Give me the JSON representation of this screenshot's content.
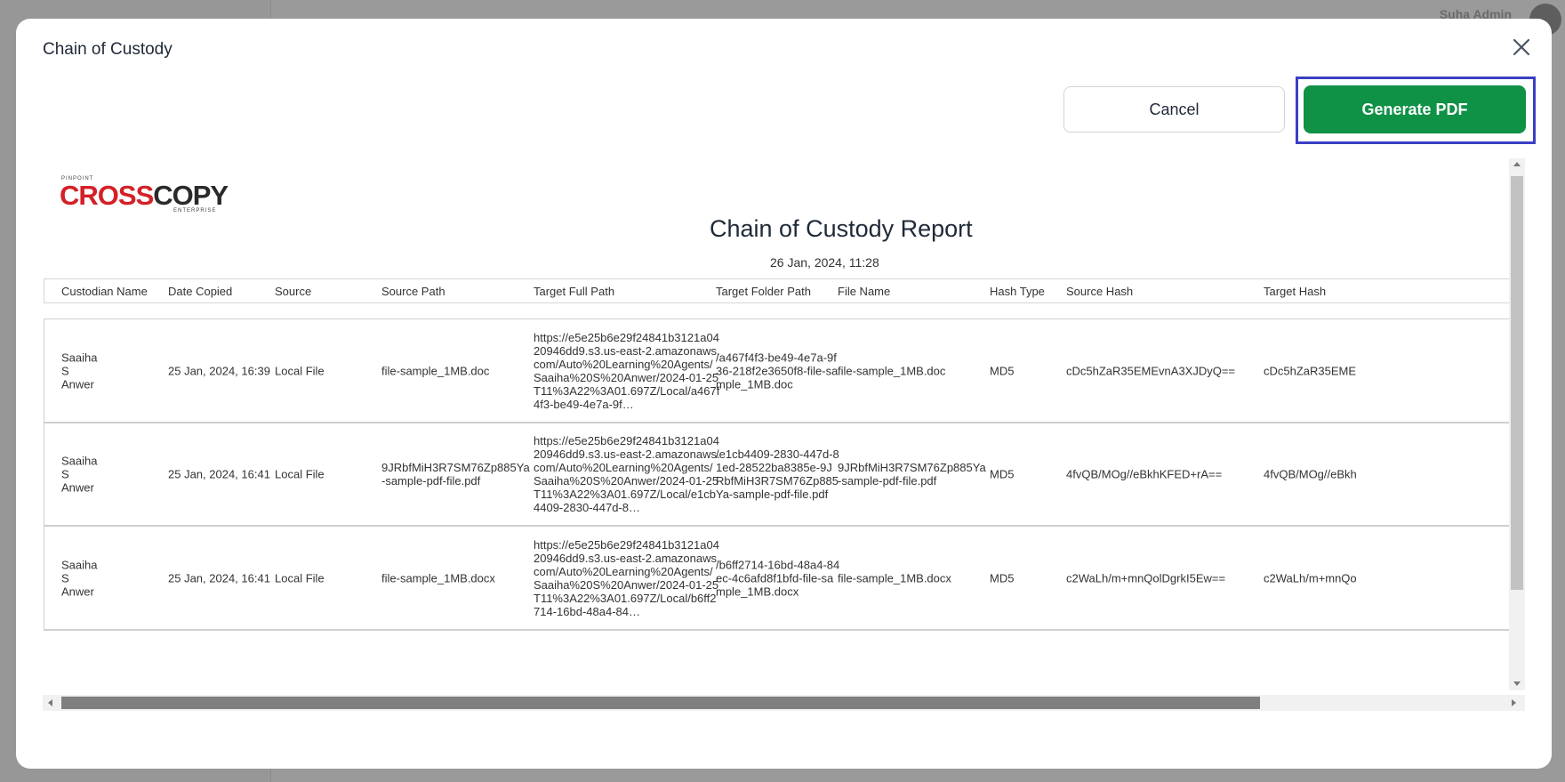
{
  "background": {
    "user_name": "Suha Admin"
  },
  "modal": {
    "title": "Chain of Custody",
    "cancel_label": "Cancel",
    "generate_label": "Generate PDF"
  },
  "report": {
    "logo": {
      "top_text": "PINPOINT",
      "cross": "CROSS",
      "copy": "COPY",
      "sub_text": "ENTERPRISE"
    },
    "title": "Chain of Custody Report",
    "date": "26 Jan, 2024, 11:28",
    "columns": [
      "Custodian Name",
      "Date Copied",
      "Source",
      "Source Path",
      "Target Full Path",
      "Target Folder Path",
      "File Name",
      "Hash Type",
      "Source Hash",
      "Target Hash"
    ],
    "rows": [
      {
        "custodian": "Saaiha\nS\nAnwer",
        "date_copied": "25 Jan, 2024, 16:39",
        "source": "Local File",
        "source_path": "file-sample_1MB.doc",
        "target_full_path": "https://e5e25b6e29f24841b3121a0420946dd9.s3.us-east-2.amazonaws.com/Auto%20Learning%20Agents/Saaiha%20S%20Anwer/2024-01-25T11%3A22%3A01.697Z/Local/a467f4f3-be49-4e7a-9f…",
        "target_folder_path": "/a467f4f3-be49-4e7a-9f36-218f2e3650f8-file-sample_1MB.doc",
        "file_name": "file-sample_1MB.doc",
        "hash_type": "MD5",
        "source_hash": "cDc5hZaR35EMEvnA3XJDyQ==",
        "target_hash": "cDc5hZaR35EME"
      },
      {
        "custodian": "Saaiha\nS\nAnwer",
        "date_copied": "25 Jan, 2024, 16:41",
        "source": "Local File",
        "source_path": "9JRbfMiH3R7SM76Zp885Ya-sample-pdf-file.pdf",
        "target_full_path": "https://e5e25b6e29f24841b3121a0420946dd9.s3.us-east-2.amazonaws.com/Auto%20Learning%20Agents/Saaiha%20S%20Anwer/2024-01-25T11%3A22%3A01.697Z/Local/e1cb4409-2830-447d-8…",
        "target_folder_path": "/e1cb4409-2830-447d-81ed-28522ba8385e-9JRbfMiH3R7SM76Zp885Ya-sample-pdf-file.pdf",
        "file_name": "9JRbfMiH3R7SM76Zp885Ya-sample-pdf-file.pdf",
        "hash_type": "MD5",
        "source_hash": "4fvQB/MOg//eBkhKFED+rA==",
        "target_hash": "4fvQB/MOg//eBkh"
      },
      {
        "custodian": "Saaiha\nS\nAnwer",
        "date_copied": "25 Jan, 2024, 16:41",
        "source": "Local File",
        "source_path": "file-sample_1MB.docx",
        "target_full_path": "https://e5e25b6e29f24841b3121a0420946dd9.s3.us-east-2.amazonaws.com/Auto%20Learning%20Agents/Saaiha%20S%20Anwer/2024-01-25T11%3A22%3A01.697Z/Local/b6ff2714-16bd-48a4-84…",
        "target_folder_path": "/b6ff2714-16bd-48a4-84ec-4c6afd8f1bfd-file-sample_1MB.docx",
        "file_name": "file-sample_1MB.docx",
        "hash_type": "MD5",
        "source_hash": "c2WaLh/m+mnQolDgrkI5Ew==",
        "target_hash": "c2WaLh/m+mnQo"
      }
    ]
  },
  "colors": {
    "primary_green": "#0f9146",
    "highlight_blue": "#3b3fc4",
    "logo_red": "#d42027"
  }
}
